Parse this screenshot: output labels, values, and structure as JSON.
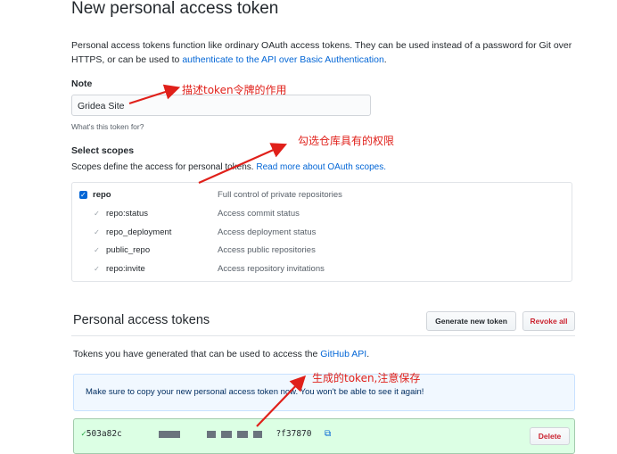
{
  "page": {
    "title": "New personal access token",
    "desc_before": "Personal access tokens function like ordinary OAuth access tokens. They can be used instead of a password for Git over HTTPS, or can be used to ",
    "desc_link": "authenticate to the API over Basic Authentication",
    "desc_after": "."
  },
  "note": {
    "label": "Note",
    "value": "Gridea Site",
    "hint": "What's this token for?"
  },
  "scopes": {
    "label": "Select scopes",
    "desc": "Scopes define the access for personal tokens.",
    "link": "Read more about OAuth scopes.",
    "items": [
      {
        "name": "repo",
        "desc": "Full control of private repositories"
      },
      {
        "name": "repo:status",
        "desc": "Access commit status"
      },
      {
        "name": "repo_deployment",
        "desc": "Access deployment status"
      },
      {
        "name": "public_repo",
        "desc": "Access public repositories"
      },
      {
        "name": "repo:invite",
        "desc": "Access repository invitations"
      }
    ]
  },
  "tokens": {
    "title": "Personal access tokens",
    "generate_label": "Generate new token",
    "revoke_label": "Revoke all",
    "desc_before": "Tokens you have generated that can be used to access the ",
    "desc_link": "GitHub API",
    "desc_after": ".",
    "flash": "Make sure to copy your new personal access token now. You won't be able to see it again!",
    "token_start": "503a82c",
    "token_end": "?f37870",
    "delete_label": "Delete"
  },
  "annotations": {
    "note": "描述token令牌的作用",
    "scopes": "勾选仓库具有的权限",
    "token": "生成的token,注意保存"
  },
  "colors": {
    "link": "#0366d6",
    "annotation": "#e0201a",
    "danger": "#cb2431",
    "success_bg": "#dcffe4"
  }
}
